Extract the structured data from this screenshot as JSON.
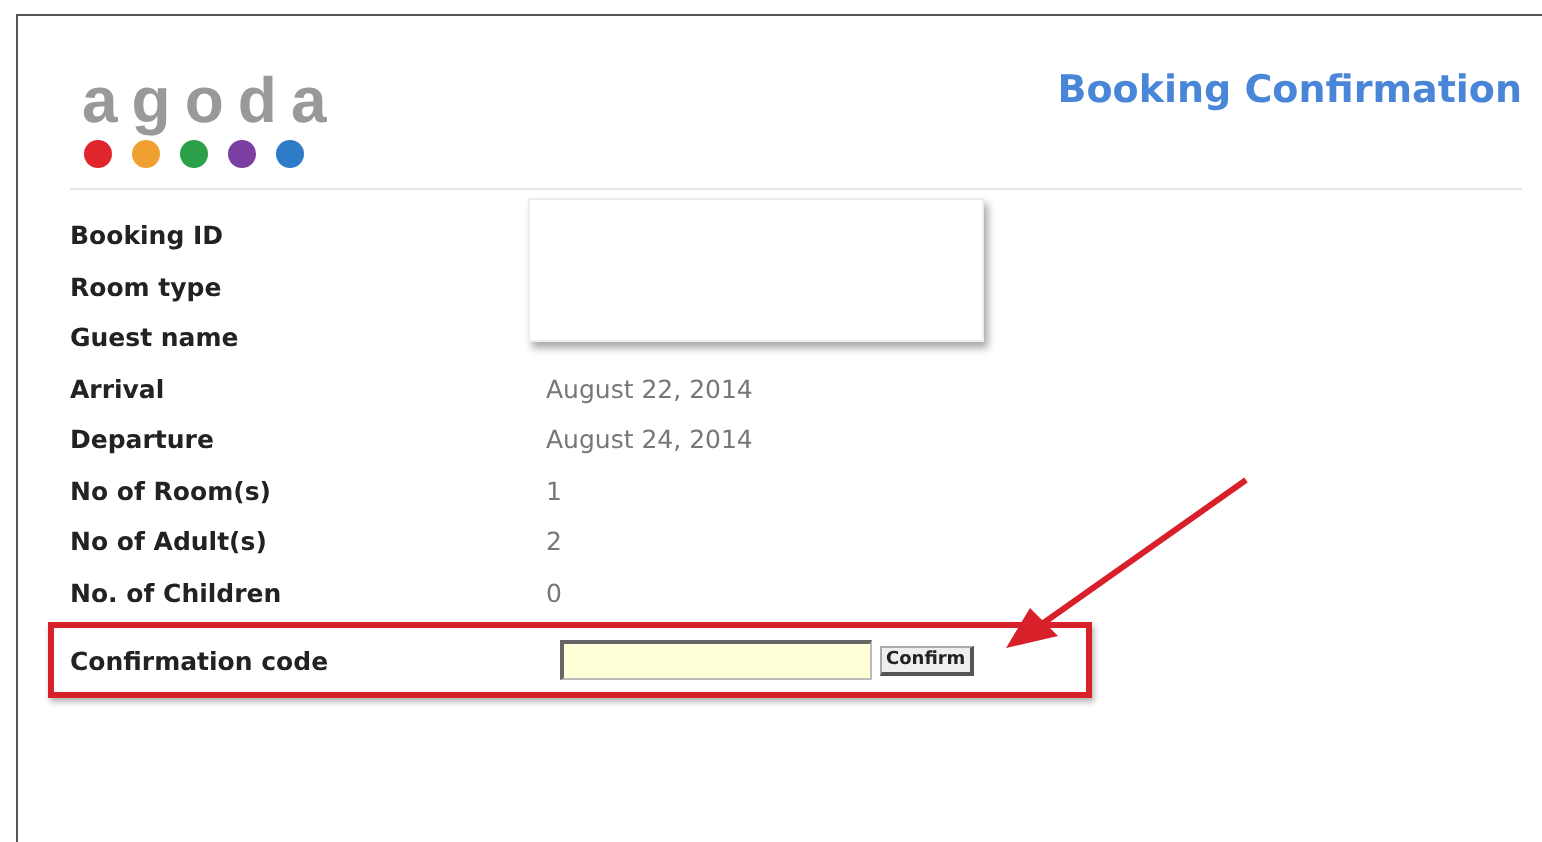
{
  "logo": {
    "text": "agoda",
    "dots": [
      {
        "color": "#e0262c"
      },
      {
        "color": "#f0a030"
      },
      {
        "color": "#2ca048"
      },
      {
        "color": "#7a3fa0"
      },
      {
        "color": "#2e7cc8"
      }
    ]
  },
  "title": "Booking Confirmation",
  "rows": [
    {
      "label": "Booking ID"
    },
    {
      "label": "Room type"
    },
    {
      "label": "Guest name"
    },
    {
      "label": "Arrival",
      "value": "August 22, 2014"
    },
    {
      "label": "Departure",
      "value": "August 24, 2014"
    },
    {
      "label": "No of Room(s)",
      "value": "1"
    },
    {
      "label": "No of Adult(s)",
      "value": "2"
    },
    {
      "label": "No. of Children",
      "value": "0"
    }
  ],
  "confirmation": {
    "label": "Confirmation code",
    "button": "Confirm"
  }
}
